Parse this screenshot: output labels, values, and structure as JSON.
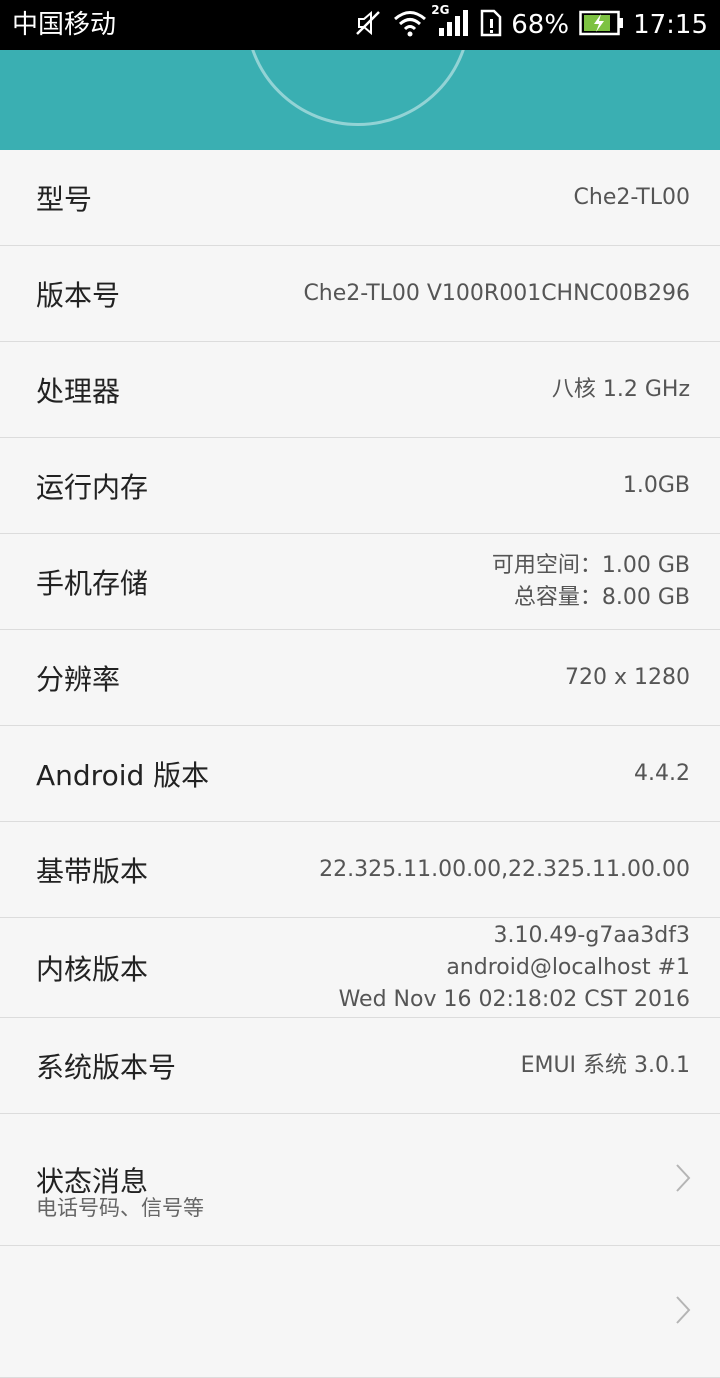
{
  "status_bar": {
    "carrier": "中国移动",
    "network_type": "2G",
    "battery_percent": "68%",
    "time": "17:15",
    "icons": [
      "mute-icon",
      "wifi-icon",
      "signal-icon",
      "sim-icon",
      "battery-charging-icon"
    ]
  },
  "colors": {
    "header": "#3aafb2",
    "background": "#f6f6f6",
    "divider": "#dcdcdc"
  },
  "rows": [
    {
      "label": "型号",
      "value": [
        "Che2-TL00"
      ]
    },
    {
      "label": "版本号",
      "value": [
        "Che2-TL00 V100R001CHNC00B296"
      ]
    },
    {
      "label": "处理器",
      "value": [
        "八核 1.2 GHz"
      ]
    },
    {
      "label": "运行内存",
      "value": [
        "1.0GB"
      ]
    },
    {
      "label": "手机存储",
      "value": [
        "可用空间：1.00 GB",
        "总容量：8.00 GB"
      ]
    },
    {
      "label": "分辨率",
      "value": [
        "720 x 1280"
      ]
    },
    {
      "label": "Android 版本",
      "value": [
        "4.4.2"
      ]
    },
    {
      "label": "基带版本",
      "value": [
        "22.325.11.00.00,22.325.11.00.00"
      ]
    },
    {
      "label": "内核版本",
      "value": [
        "3.10.49-g7aa3df3",
        "android@localhost #1",
        "Wed Nov 16 02:18:02 CST 2016"
      ]
    },
    {
      "label": "系统版本号",
      "value": [
        "EMUI 系统 3.0.1"
      ]
    }
  ],
  "status_info": {
    "label": "状态消息",
    "sublabel": "电话号码、信号等"
  }
}
